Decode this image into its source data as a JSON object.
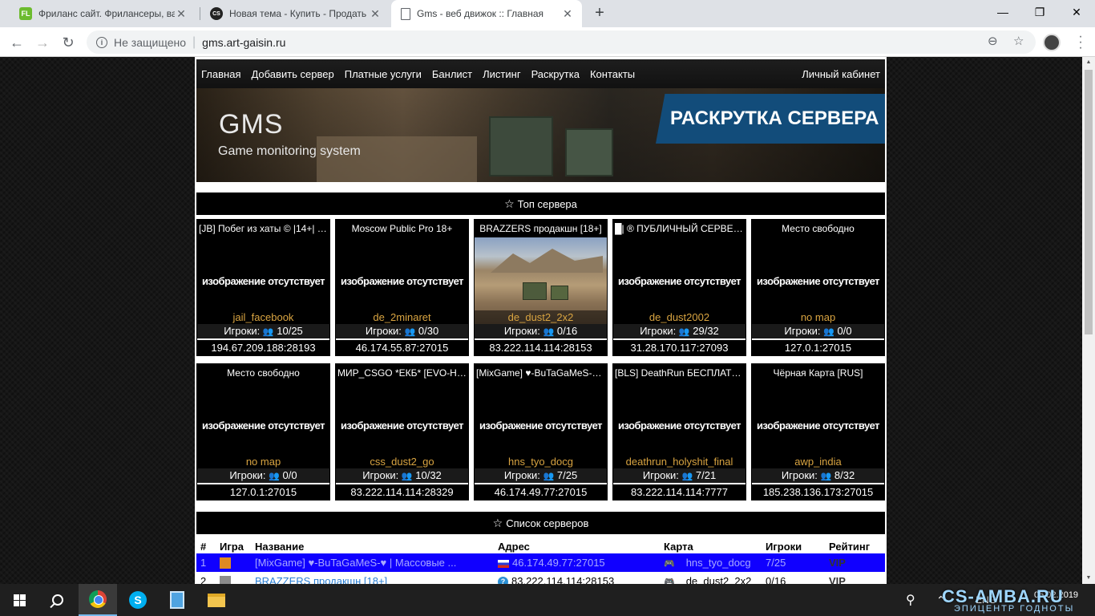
{
  "browser": {
    "tabs": [
      {
        "title": "Фриланс сайт. Фрилансеры, ва",
        "favicon": "FL"
      },
      {
        "title": "Новая тема - Купить - Продать",
        "favicon": "CS"
      },
      {
        "title": "Gms - веб движок :: Главная",
        "favicon": ""
      }
    ],
    "security_label": "Не защищено",
    "url": "gms.art-gaisin.ru"
  },
  "nav": {
    "items": [
      "Главная",
      "Добавить сервер",
      "Платные услуги",
      "Банлист",
      "Листинг",
      "Раскрутка",
      "Контакты"
    ],
    "cabinet": "Личный кабинет"
  },
  "banner": {
    "logo": "GMS",
    "subtitle": "Game monitoring system",
    "promo": "РАСКРУТКА СЕРВЕРА"
  },
  "top_section": {
    "title": "Топ сервера"
  },
  "no_image_text": "изображение отсутствует",
  "players_label": "Игроки:",
  "top_servers": [
    {
      "name": "[JB] Побег из хаты © |14+| FR...",
      "map": "jail_facebook",
      "players": "10/25",
      "address": "194.67.209.188:28193",
      "photo": false
    },
    {
      "name": "Moscow Public Pro 18+",
      "map": "de_2minaret",
      "players": "0/30",
      "address": "46.174.55.87:27015",
      "photo": false
    },
    {
      "name": "BRAZZERS продакшн [18+]",
      "map": "de_dust2_2x2",
      "players": "0/16",
      "address": "83.222.114.114:28153",
      "photo": true
    },
    {
      "name": "█| ® ПУБЛИЧНЫЙ СЕРВЕР™...",
      "map": "de_dust2002",
      "players": "29/32",
      "address": "31.28.170.117:27093",
      "photo": false
    },
    {
      "name": "Место свободно",
      "map": "no map",
      "players": "0/0",
      "address": "127.0.1:27015",
      "photo": false
    },
    {
      "name": "Место свободно",
      "map": "no map",
      "players": "0/0",
      "address": "127.0.1:27015",
      "photo": false
    },
    {
      "name": "МИР_CSGO *ЕКБ* [EVO-HOST...",
      "map": "css_dust2_go",
      "players": "10/32",
      "address": "83.222.114.114:28329",
      "photo": false
    },
    {
      "name": "[MixGame] ♥-BuTaGaMeS-♥ | ...",
      "map": "hns_tyo_docg",
      "players": "7/25",
      "address": "46.174.49.77:27015",
      "photo": false
    },
    {
      "name": "[BLS] DeathRun БЕСПЛАТНАЯ...",
      "map": "deathrun_holyshit_final",
      "players": "7/21",
      "address": "83.222.114.114:7777",
      "photo": false
    },
    {
      "name": "Чёрная Карта [RUS]",
      "map": "awp_india",
      "players": "8/32",
      "address": "185.238.136.173:27015",
      "photo": false
    }
  ],
  "list_section": {
    "title": "Список серверов"
  },
  "list_columns": [
    "#",
    "Игра",
    "Название",
    "Адрес",
    "Карта",
    "Игроки",
    "Рейтинг"
  ],
  "list_rows": [
    {
      "num": "1",
      "game": "orange",
      "name": "[MixGame] ♥-BuTaGaMeS-♥ | Массовые ...",
      "flag": "ru",
      "address": "46.174.49.77:27015",
      "map": "hns_tyo_docg",
      "players": "7/25",
      "rating": "VIP",
      "selected": true
    },
    {
      "num": "2",
      "game": "grey",
      "name": "BRAZZERS продакшн [18+]",
      "flag": "unknown",
      "address": "83.222.114.114:28153",
      "map": "de_dust2_2x2",
      "players": "0/16",
      "rating": "VIP",
      "selected": false
    }
  ],
  "taskbar": {
    "lang": "ENG",
    "date": "05.02.2019",
    "watermark": "CS-AMBA.RU",
    "watermark_sub": "ЭПИЦЕНТР ГОДНОТЫ"
  },
  "colors": {
    "map_text": "#d9a441",
    "selected_row": "#1000ff",
    "link": "#2a7fd4",
    "promo_bg": "#124c7a"
  }
}
